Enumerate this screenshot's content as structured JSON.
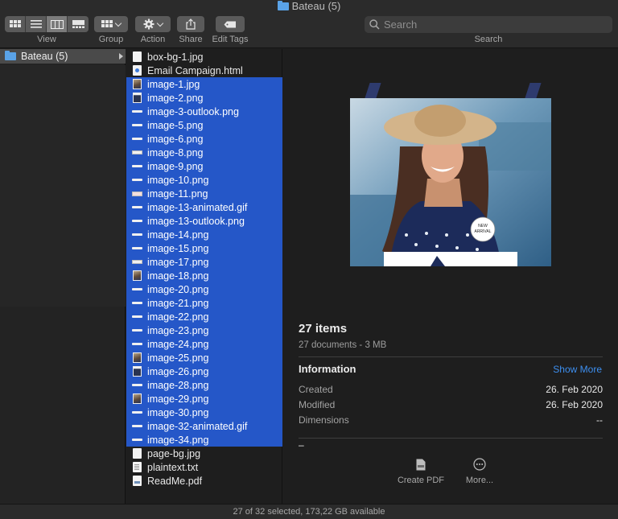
{
  "window": {
    "title": "Bateau (5)"
  },
  "toolbar": {
    "view_label": "View",
    "group_label": "Group",
    "action_label": "Action",
    "share_label": "Share",
    "edit_tags_label": "Edit Tags",
    "search_label": "Search",
    "search_placeholder": "Search",
    "active_view": "columns"
  },
  "sidebar_column": {
    "items": [
      {
        "label": "Bateau (5)",
        "icon": "folder-icon",
        "selected": true
      }
    ]
  },
  "files": [
    {
      "name": "box-bg-1.jpg",
      "icon": "white",
      "selected": false
    },
    {
      "name": "Email Campaign.html",
      "icon": "html",
      "selected": false
    },
    {
      "name": "image-1.jpg",
      "icon": "photo",
      "selected": true
    },
    {
      "name": "image-2.png",
      "icon": "dark",
      "selected": true
    },
    {
      "name": "image-3-outlook.png",
      "icon": "line",
      "selected": true
    },
    {
      "name": "image-5.png",
      "icon": "line",
      "selected": true
    },
    {
      "name": "image-6.png",
      "icon": "line",
      "selected": true
    },
    {
      "name": "image-8.png",
      "icon": "slim",
      "selected": true
    },
    {
      "name": "image-9.png",
      "icon": "line",
      "selected": true
    },
    {
      "name": "image-10.png",
      "icon": "line",
      "selected": true
    },
    {
      "name": "image-11.png",
      "icon": "pink",
      "selected": true
    },
    {
      "name": "image-13-animated.gif",
      "icon": "line",
      "selected": true
    },
    {
      "name": "image-13-outlook.png",
      "icon": "line",
      "selected": true
    },
    {
      "name": "image-14.png",
      "icon": "line",
      "selected": true
    },
    {
      "name": "image-15.png",
      "icon": "line",
      "selected": true
    },
    {
      "name": "image-17.png",
      "icon": "slim",
      "selected": true
    },
    {
      "name": "image-18.png",
      "icon": "photo",
      "selected": true
    },
    {
      "name": "image-20.png",
      "icon": "line",
      "selected": true
    },
    {
      "name": "image-21.png",
      "icon": "line",
      "selected": true
    },
    {
      "name": "image-22.png",
      "icon": "line",
      "selected": true
    },
    {
      "name": "image-23.png",
      "icon": "line",
      "selected": true
    },
    {
      "name": "image-24.png",
      "icon": "line",
      "selected": true
    },
    {
      "name": "image-25.png",
      "icon": "photo",
      "selected": true
    },
    {
      "name": "image-26.png",
      "icon": "dark",
      "selected": true
    },
    {
      "name": "image-28.png",
      "icon": "line",
      "selected": true
    },
    {
      "name": "image-29.png",
      "icon": "photo",
      "selected": true
    },
    {
      "name": "image-30.png",
      "icon": "line",
      "selected": true
    },
    {
      "name": "image-32-animated.gif",
      "icon": "line",
      "selected": true
    },
    {
      "name": "image-34.png",
      "icon": "line",
      "selected": true
    },
    {
      "name": "page-bg.jpg",
      "icon": "white",
      "selected": false
    },
    {
      "name": "plaintext.txt",
      "icon": "doc",
      "selected": false
    },
    {
      "name": "ReadMe.pdf",
      "icon": "pdf",
      "selected": false
    }
  ],
  "preview": {
    "badge_line1": "NEW",
    "badge_line2": "ARRIVAL",
    "items_count": "27 items",
    "items_sub": "27 documents - 3 MB",
    "info_title": "Information",
    "show_more": "Show More",
    "created_label": "Created",
    "created_value": "26. Feb 2020",
    "modified_label": "Modified",
    "modified_value": "26. Feb 2020",
    "dimensions_label": "Dimensions",
    "dimensions_value": "--",
    "dash": "–",
    "create_pdf_label": "Create PDF",
    "more_label": "More..."
  },
  "statusbar": {
    "text": "27 of 32 selected, 173,22 GB available"
  },
  "colors": {
    "selection": "#2557c8",
    "accent_link": "#3d8ff0",
    "folder": "#5aa3e8"
  }
}
